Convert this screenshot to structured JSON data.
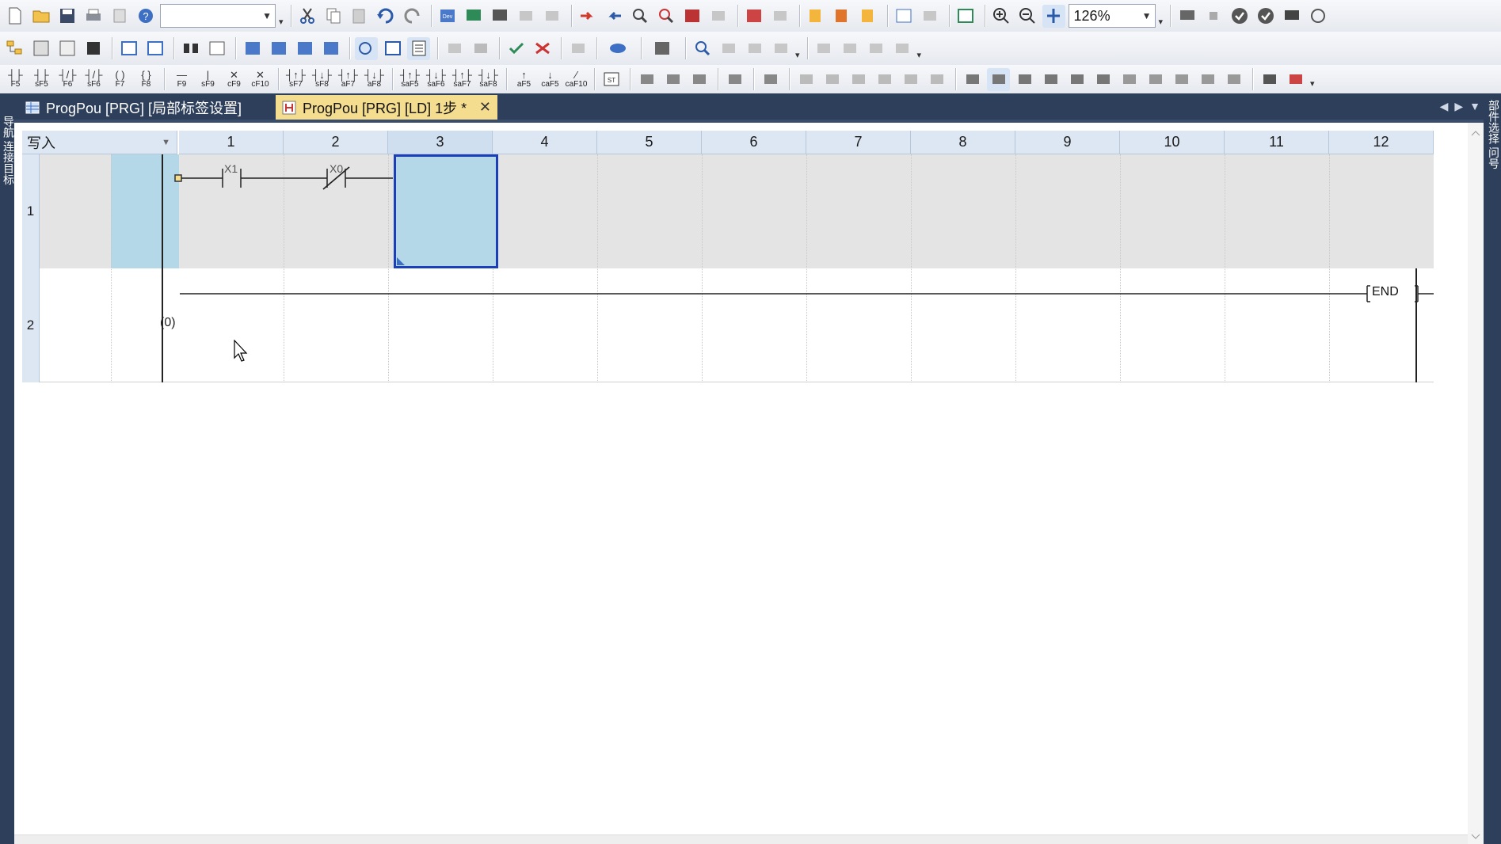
{
  "toolbar": {
    "zoom_value": "126%",
    "search_combo_value": "",
    "function_keys": [
      {
        "sym": "┤├",
        "label": "F5"
      },
      {
        "sym": "┤├",
        "label": "sF5"
      },
      {
        "sym": "┤/├",
        "label": "F6"
      },
      {
        "sym": "┤/├",
        "label": "sF6"
      },
      {
        "sym": "( )",
        "label": "F7"
      },
      {
        "sym": "{ }",
        "label": "F8"
      },
      {
        "sym": "—",
        "label": "F9"
      },
      {
        "sym": "|",
        "label": "sF9"
      },
      {
        "sym": "✕",
        "label": "cF9"
      },
      {
        "sym": "✕",
        "label": "cF10"
      },
      {
        "sym": "┤↑├",
        "label": "sF7"
      },
      {
        "sym": "┤↓├",
        "label": "sF8"
      },
      {
        "sym": "┤↑├",
        "label": "aF7"
      },
      {
        "sym": "┤↓├",
        "label": "aF8"
      },
      {
        "sym": "┤↑├",
        "label": "saF5"
      },
      {
        "sym": "┤↓├",
        "label": "saF6"
      },
      {
        "sym": "┤↑├",
        "label": "saF7"
      },
      {
        "sym": "┤↓├",
        "label": "saF8"
      },
      {
        "sym": "↑",
        "label": "aF5"
      },
      {
        "sym": "↓",
        "label": "caF5"
      },
      {
        "sym": "⁄",
        "label": "caF10"
      }
    ]
  },
  "tabs": {
    "inactive_label": "ProgPou [PRG] [局部标签设置]",
    "active_label": "ProgPou [PRG] [LD] 1步 *",
    "close_symbol": "✕"
  },
  "side_panels": {
    "left_text": "导航 连接目标",
    "right_text": "部件选择 问号"
  },
  "editor": {
    "mode_label": "写入",
    "columns": [
      "1",
      "2",
      "3",
      "4",
      "5",
      "6",
      "7",
      "8",
      "9",
      "10",
      "11",
      "12"
    ],
    "rows": [
      {
        "number": "1",
        "step": ""
      },
      {
        "number": "2",
        "step": "(0)"
      }
    ],
    "contacts": [
      {
        "device": "X1",
        "type": "normally-open"
      },
      {
        "device": "X0",
        "type": "normally-closed"
      }
    ],
    "end_instruction": "END",
    "selected_column": "3"
  },
  "colors": {
    "tab_active": "#f5dd8f",
    "selection_border": "#1a3fb8",
    "selection_fill": "#b4d8e8",
    "frame": "#2d3f5b"
  }
}
